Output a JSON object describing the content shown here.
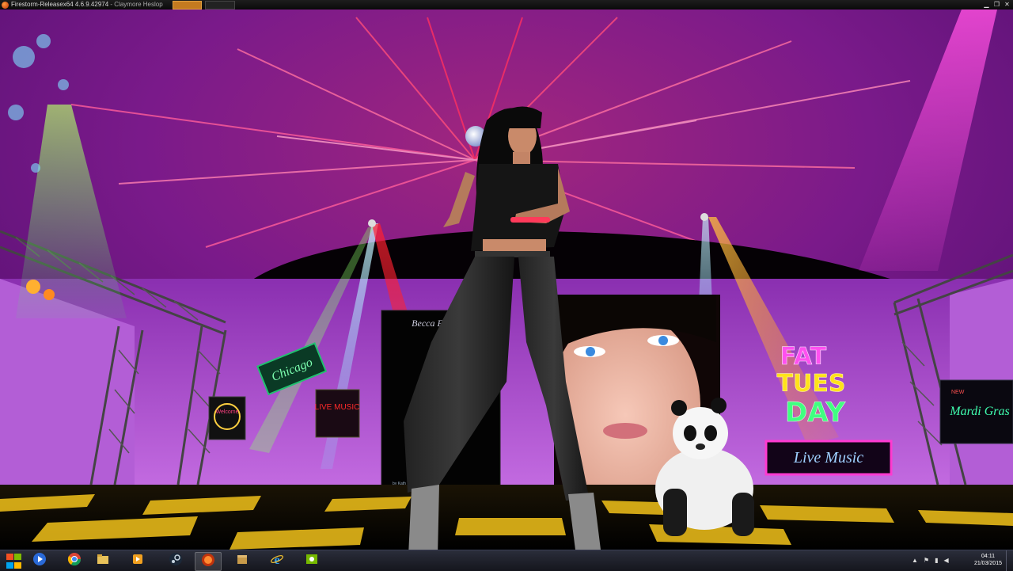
{
  "window": {
    "title": "Firestorm-Releasex64 4.6.9.42974",
    "separator": " - ",
    "user": "Claymore Heslop"
  },
  "window_controls": [
    "minimize",
    "restore",
    "close"
  ],
  "scene": {
    "signs": {
      "chicago_logo": "Chicago",
      "welcome_neon": "Welcome",
      "live_music_left": "LIVE MUSIC",
      "banner_top": "Becca Fashion",
      "banner_credit": "by Kath",
      "fat_tuesday_line1": "FAT",
      "fat_tuesday_line2": "TUES",
      "fat_tuesday_line3": "DAY",
      "live_music_right": "Live Music",
      "mardi_gras": "Mardi Gras",
      "mardi_gras_small": "NEW"
    },
    "colors": {
      "sky": "#6a1a8c",
      "wall": "#b04ad0",
      "floor_light": "#f2c21a",
      "spot_pink": "#ff40d0",
      "spot_green": "#40ff60"
    }
  },
  "taskbar": {
    "pinned": [
      {
        "name": "windows-media-player-icon",
        "title": "Windows Media Player"
      },
      {
        "name": "chrome-icon",
        "title": "Google Chrome"
      },
      {
        "name": "file-explorer-icon",
        "title": "Windows Explorer"
      },
      {
        "name": "media-player-icon",
        "title": "Media Player"
      },
      {
        "name": "steam-icon",
        "title": "Steam"
      },
      {
        "name": "firestorm-icon",
        "title": "Firestorm Viewer"
      },
      {
        "name": "package-icon",
        "title": "Setup"
      },
      {
        "name": "internet-explorer-icon",
        "title": "Internet Explorer"
      },
      {
        "name": "nvidia-icon",
        "title": "NVIDIA"
      }
    ],
    "active_index": 5,
    "clock": {
      "time": "04:11",
      "date": "21/03/2015"
    }
  }
}
